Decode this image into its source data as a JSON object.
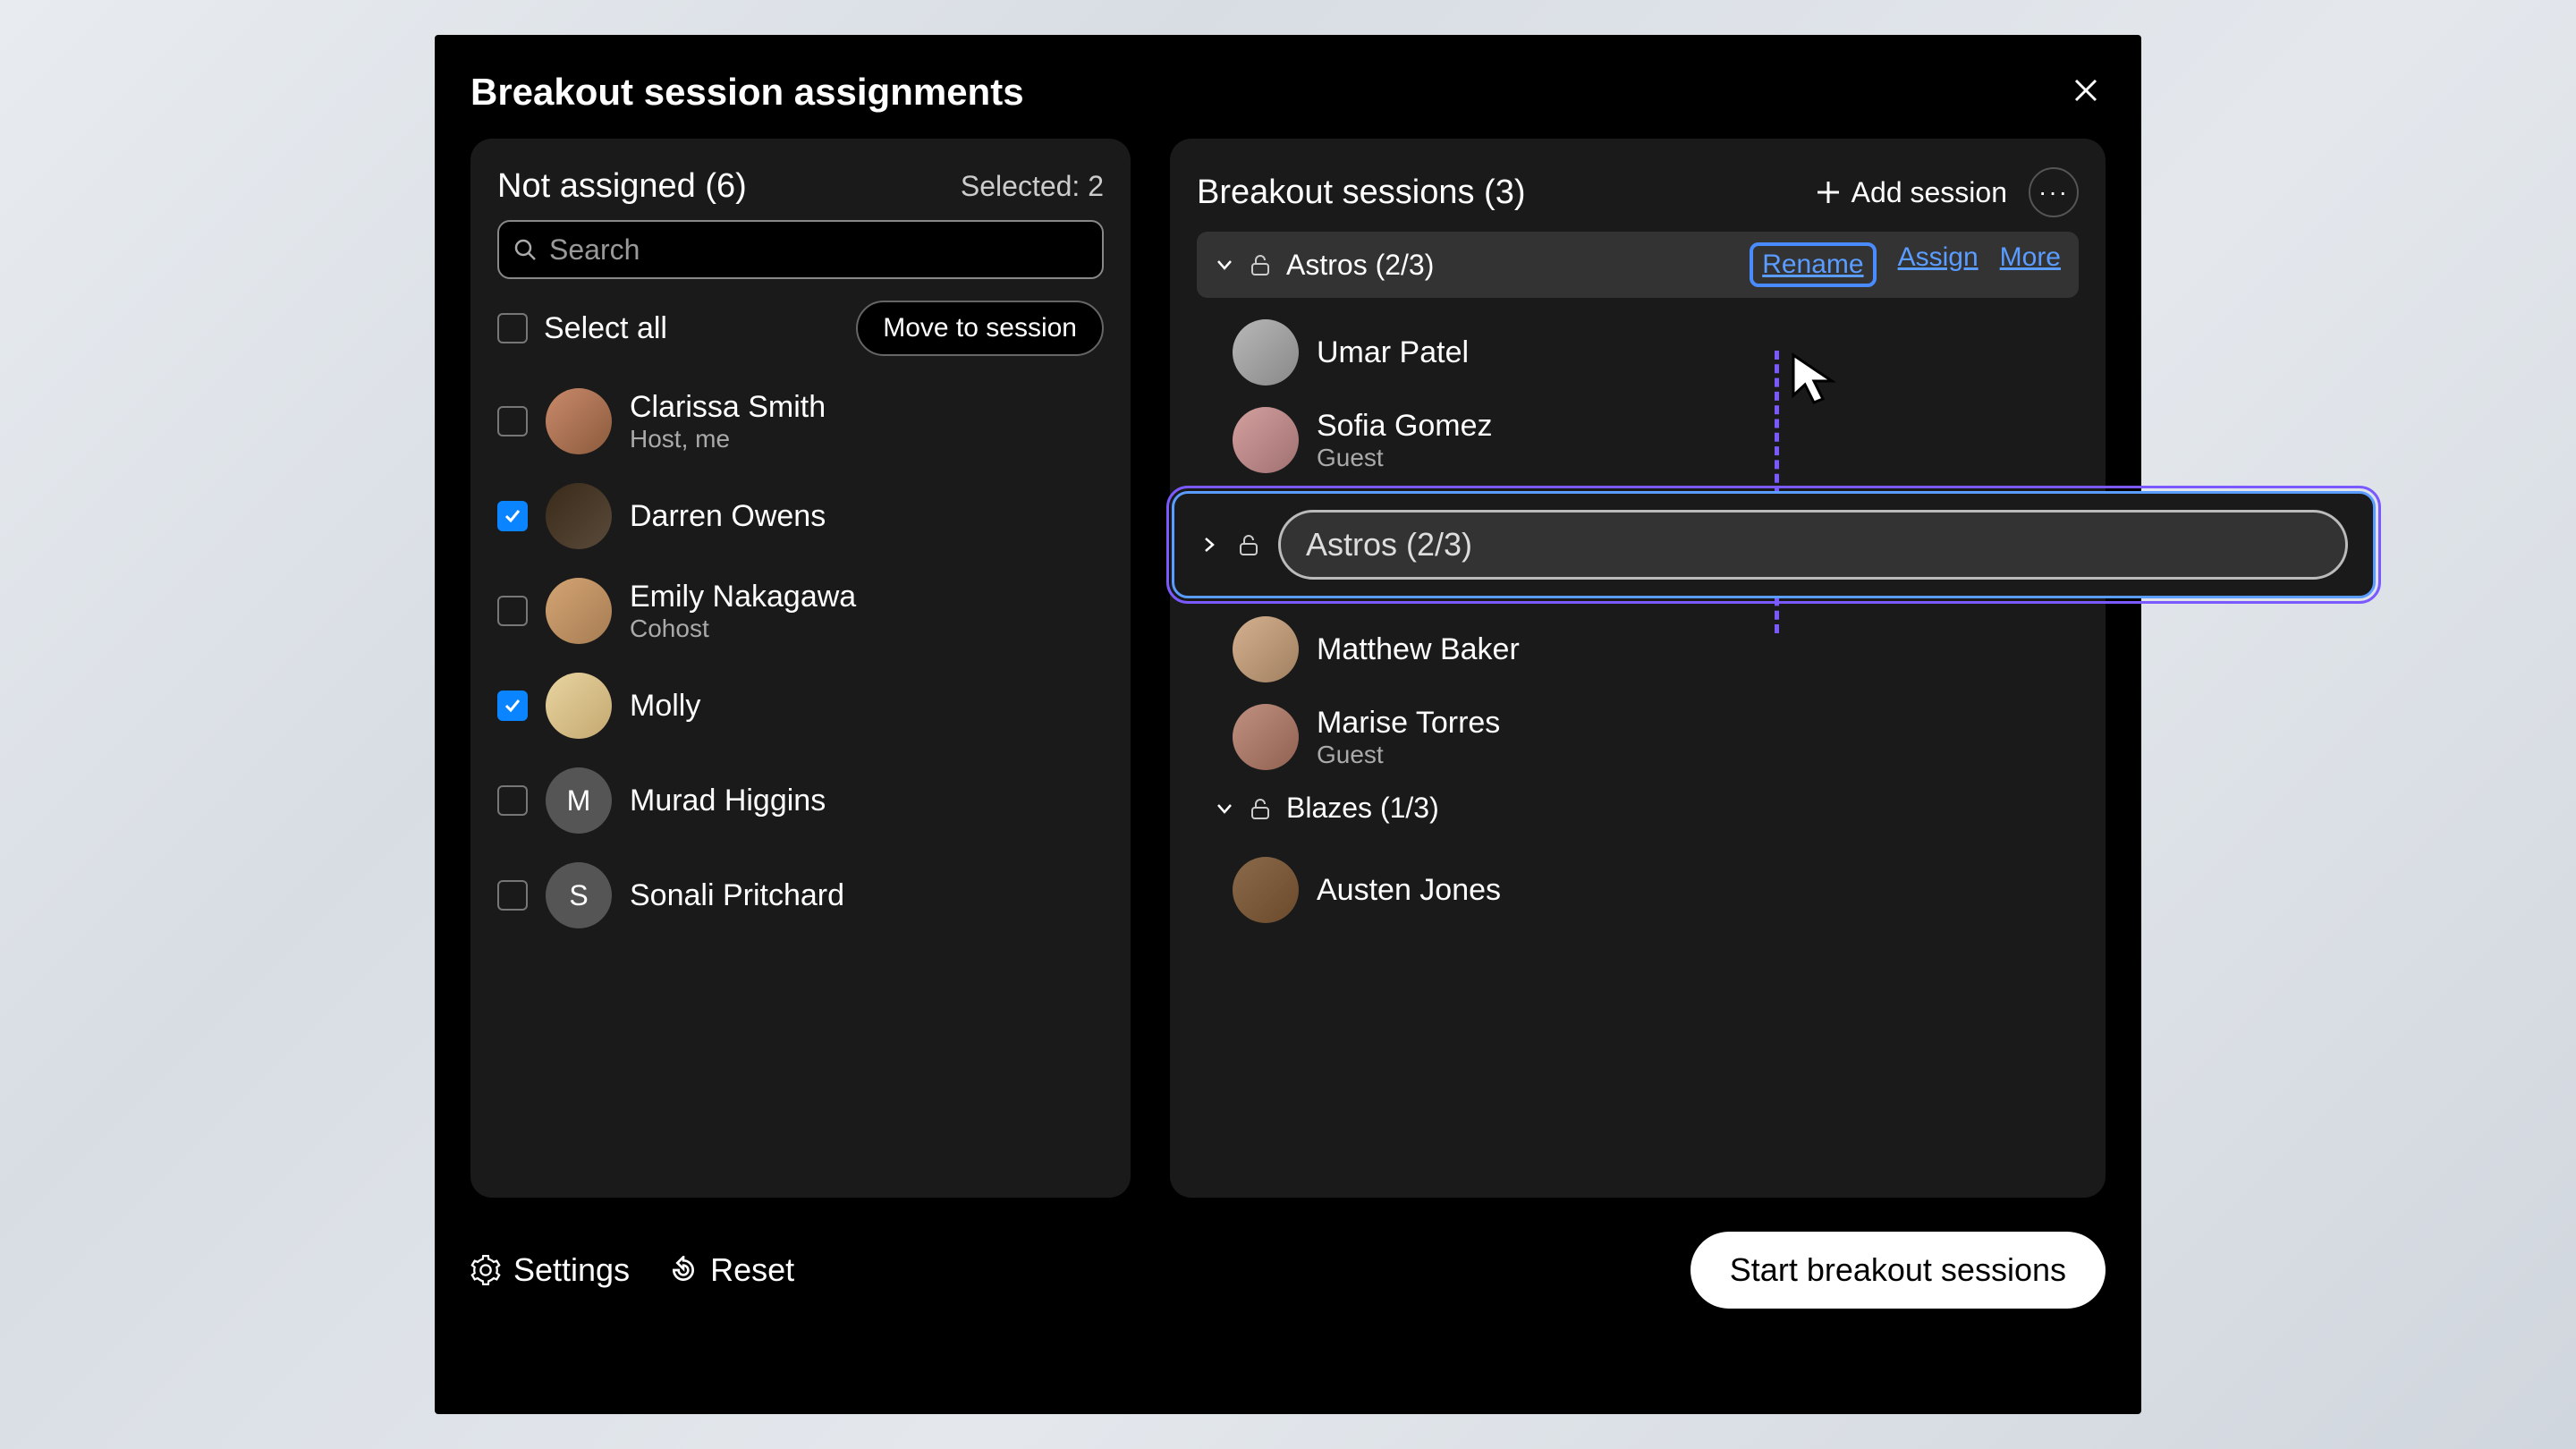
{
  "title": "Breakout session assignments",
  "leftPanel": {
    "title": "Not assigned (6)",
    "selected": "Selected: 2",
    "searchPlaceholder": "Search",
    "selectAll": "Select all",
    "moveButton": "Move to session",
    "people": [
      {
        "name": "Clarissa Smith",
        "role": "Host, me",
        "checked": false,
        "avatarClass": "c1"
      },
      {
        "name": "Darren Owens",
        "role": "",
        "checked": true,
        "avatarClass": "c2"
      },
      {
        "name": "Emily Nakagawa",
        "role": "Cohost",
        "checked": false,
        "avatarClass": "c3"
      },
      {
        "name": "Molly",
        "role": "",
        "checked": true,
        "avatarClass": "c4"
      },
      {
        "name": "Murad Higgins",
        "role": "",
        "checked": false,
        "avatarClass": "c5",
        "initial": "M"
      },
      {
        "name": "Sonali Pritchard",
        "role": "",
        "checked": false,
        "avatarClass": "c6",
        "initial": "S"
      }
    ]
  },
  "rightPanel": {
    "title": "Breakout sessions (3)",
    "addSession": "Add session",
    "sessions": [
      {
        "name": "Astros (2/3)",
        "actions": {
          "rename": "Rename",
          "assign": "Assign",
          "more": "More"
        },
        "members": [
          {
            "name": "Umar Patel",
            "role": "",
            "avatarClass": "c7"
          },
          {
            "name": "Sofia Gomez",
            "role": "Guest",
            "avatarClass": "c8"
          }
        ]
      },
      {
        "name": "Astros (2/3)",
        "renameMode": true,
        "members": [
          {
            "name": "Matthew Baker",
            "role": "",
            "avatarClass": "c9"
          },
          {
            "name": "Marise Torres",
            "role": "Guest",
            "avatarClass": "c10"
          }
        ]
      },
      {
        "name": "Blazes (1/3)",
        "members": [
          {
            "name": "Austen Jones",
            "role": "",
            "avatarClass": "c11"
          }
        ]
      }
    ]
  },
  "footer": {
    "settings": "Settings",
    "reset": "Reset",
    "start": "Start breakout sessions"
  }
}
